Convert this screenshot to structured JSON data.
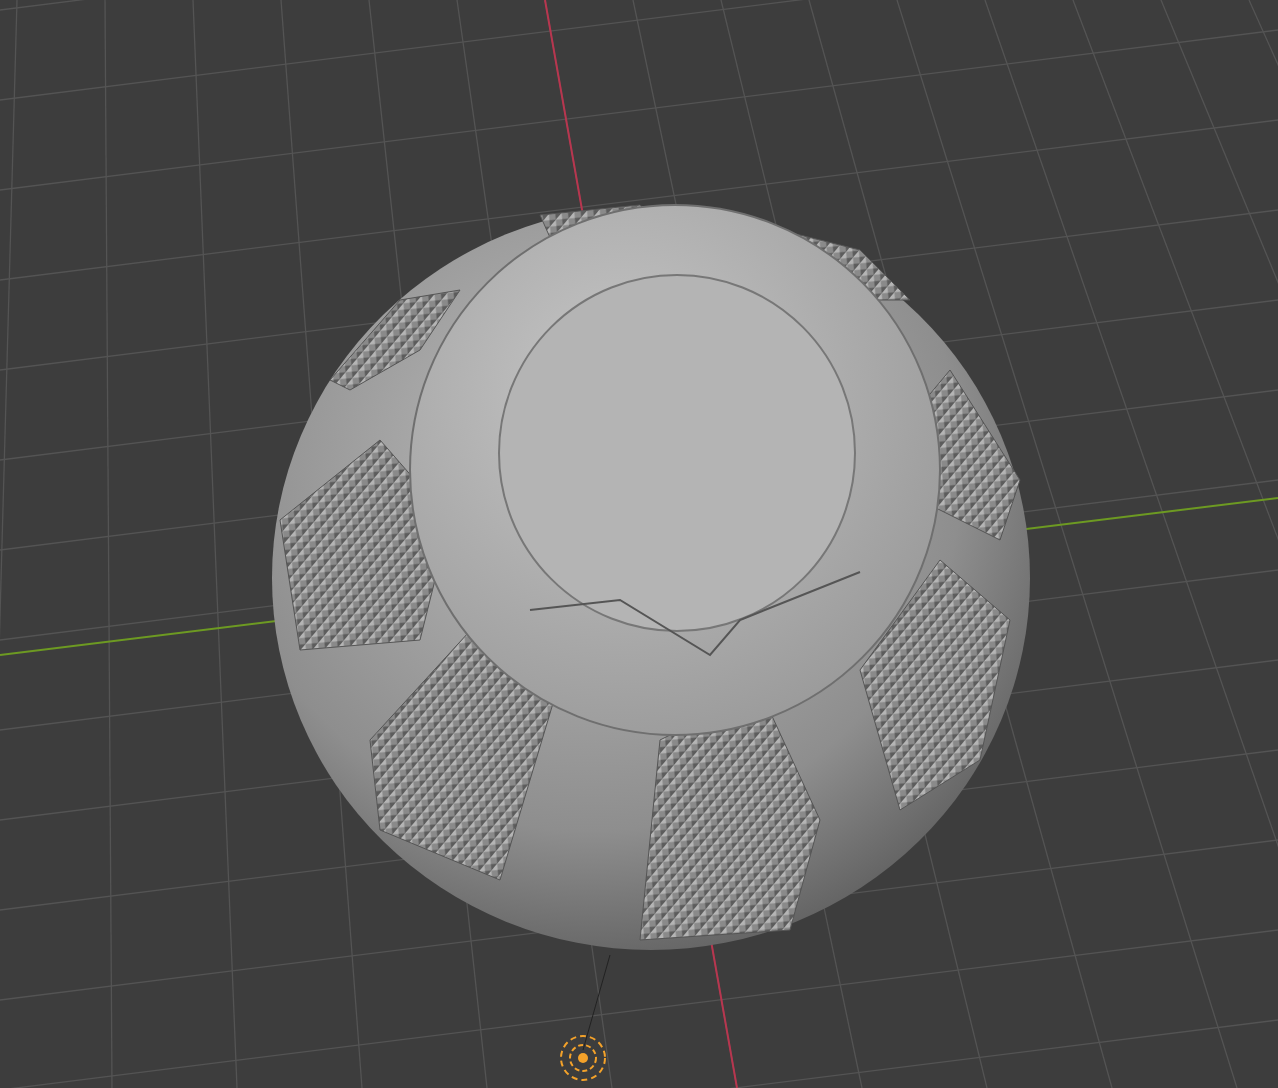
{
  "viewport": {
    "grid": true,
    "axes": [
      {
        "kind": "x",
        "color": "#b8364f"
      },
      {
        "kind": "y",
        "color": "#6d9a22"
      }
    ]
  },
  "objects": [
    {
      "kind": "mesh"
    },
    {
      "kind": "light",
      "selected": true
    }
  ]
}
